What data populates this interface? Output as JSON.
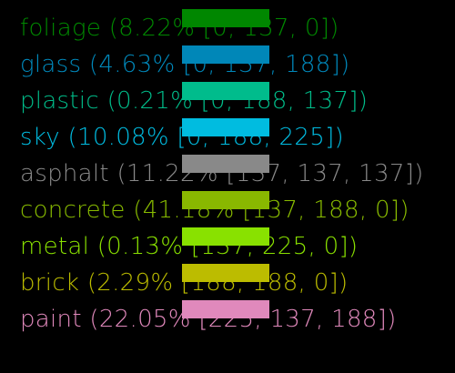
{
  "legend": [
    {
      "text": "foliage (8.22% [0, 137, 0])",
      "color": "#008900",
      "swatch": "#008700"
    },
    {
      "text": "glass (4.63% [0, 137, 188])",
      "color": "#0089bc",
      "swatch": "#0087b8"
    },
    {
      "text": "plastic (0.21% [0, 188, 137])",
      "color": "#00bc89",
      "swatch": "#00bc8c"
    },
    {
      "text": "sky (10.08% [0, 188, 225])",
      "color": "#00bce1",
      "swatch": "#00bce0"
    },
    {
      "text": "asphalt (11.22% [137, 137, 137])",
      "color": "#898989",
      "swatch": "#898989"
    },
    {
      "text": "concrete (41.18% [137, 188, 0])",
      "color": "#89bc00",
      "swatch": "#89b800"
    },
    {
      "text": "metal (0.13% [137, 225, 0])",
      "color": "#89e100",
      "swatch": "#89e100"
    },
    {
      "text": "brick (2.29% [188, 188, 0])",
      "color": "#bcbc00",
      "swatch": "#bcbc00"
    },
    {
      "text": "paint (22.05% [225, 137, 188])",
      "color": "#e189bc",
      "swatch": "#e089bc"
    }
  ]
}
